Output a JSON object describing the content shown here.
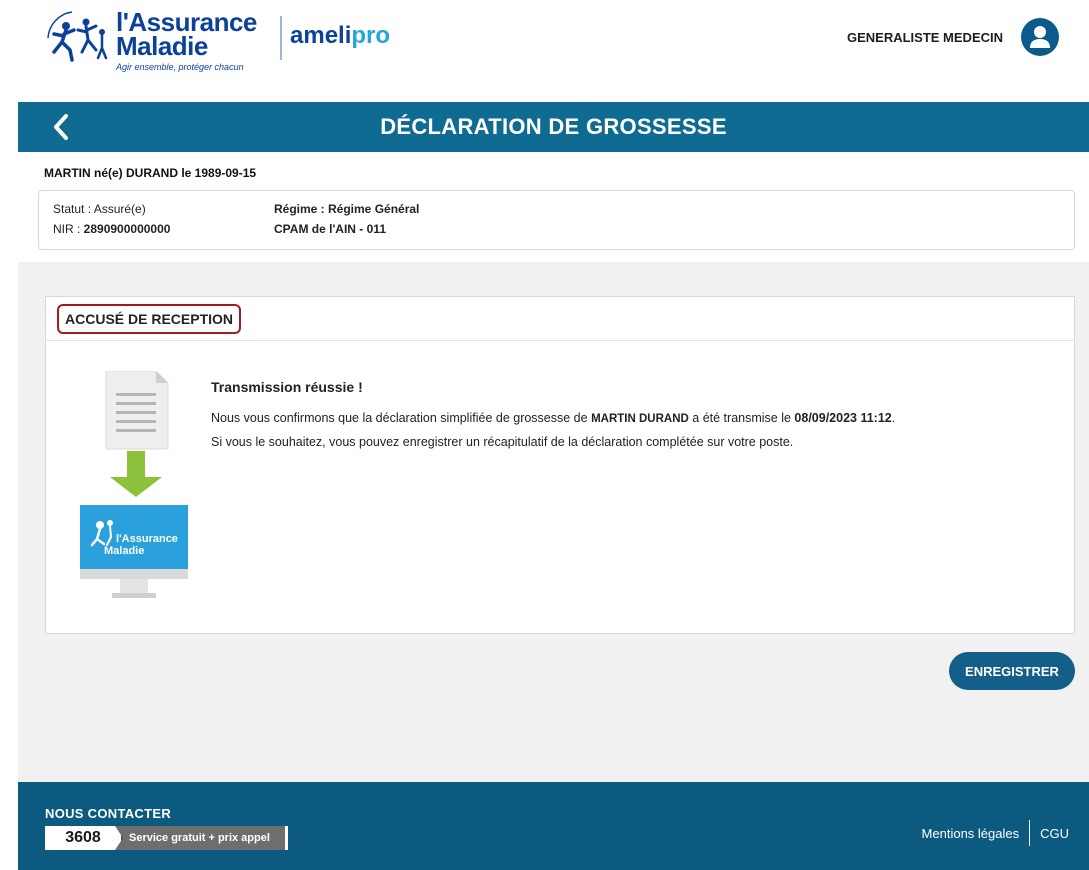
{
  "header": {
    "logo_line1": "l'Assurance",
    "logo_line2": "Maladie",
    "logo_tagline": "Agir ensemble, protéger chacun",
    "app_name_prefix": "ameli",
    "app_name_suffix": "pro",
    "user_role": "GENERALISTE MEDECIN",
    "avatar_icon": "user-avatar-icon"
  },
  "title_bar": {
    "back_icon": "chevron-left-icon",
    "title": "DÉCLARATION DE GROSSESSE"
  },
  "patient": {
    "identity": "MARTIN  né(e) DURAND  le 1989-09-15",
    "status_label": "Statut : Assuré(e)",
    "nir_label": "NIR : ",
    "nir_value": "2890900000000",
    "regime_label": "Régime : Régime Général",
    "cpam_label": "CPAM de l'AIN - 011"
  },
  "receipt": {
    "section_title": "ACCUSÉ DE RECEPTION",
    "success_title": "Transmission réussie !",
    "message_part1": "Nous vous confirmons que la déclaration simplifiée de grossesse de ",
    "message_name": "MARTIN DURAND",
    "message_part2": "  a été transmise le ",
    "message_datetime": "08/09/2023 11:12",
    "message_part3": ".",
    "message_line2": "Si vous le souhaitez, vous pouvez enregistrer un récapitulatif de la déclaration complétée sur votre poste.",
    "illustration_logo_line1": "l'Assurance",
    "illustration_logo_line2": "Maladie"
  },
  "actions": {
    "save_label": "ENREGISTRER"
  },
  "footer": {
    "contact_title": "NOUS CONTACTER",
    "phone_number": "3608",
    "phone_info": "Service gratuit + prix appel",
    "legal_link": "Mentions légales",
    "cgu_link": "CGU"
  },
  "colors": {
    "brand_blue": "#0c419a",
    "title_bar": "#0f6b91",
    "footer": "#0c5a80",
    "button": "#135f8a",
    "highlight_border": "#a61b1b",
    "arrow_green": "#8dc13b"
  }
}
